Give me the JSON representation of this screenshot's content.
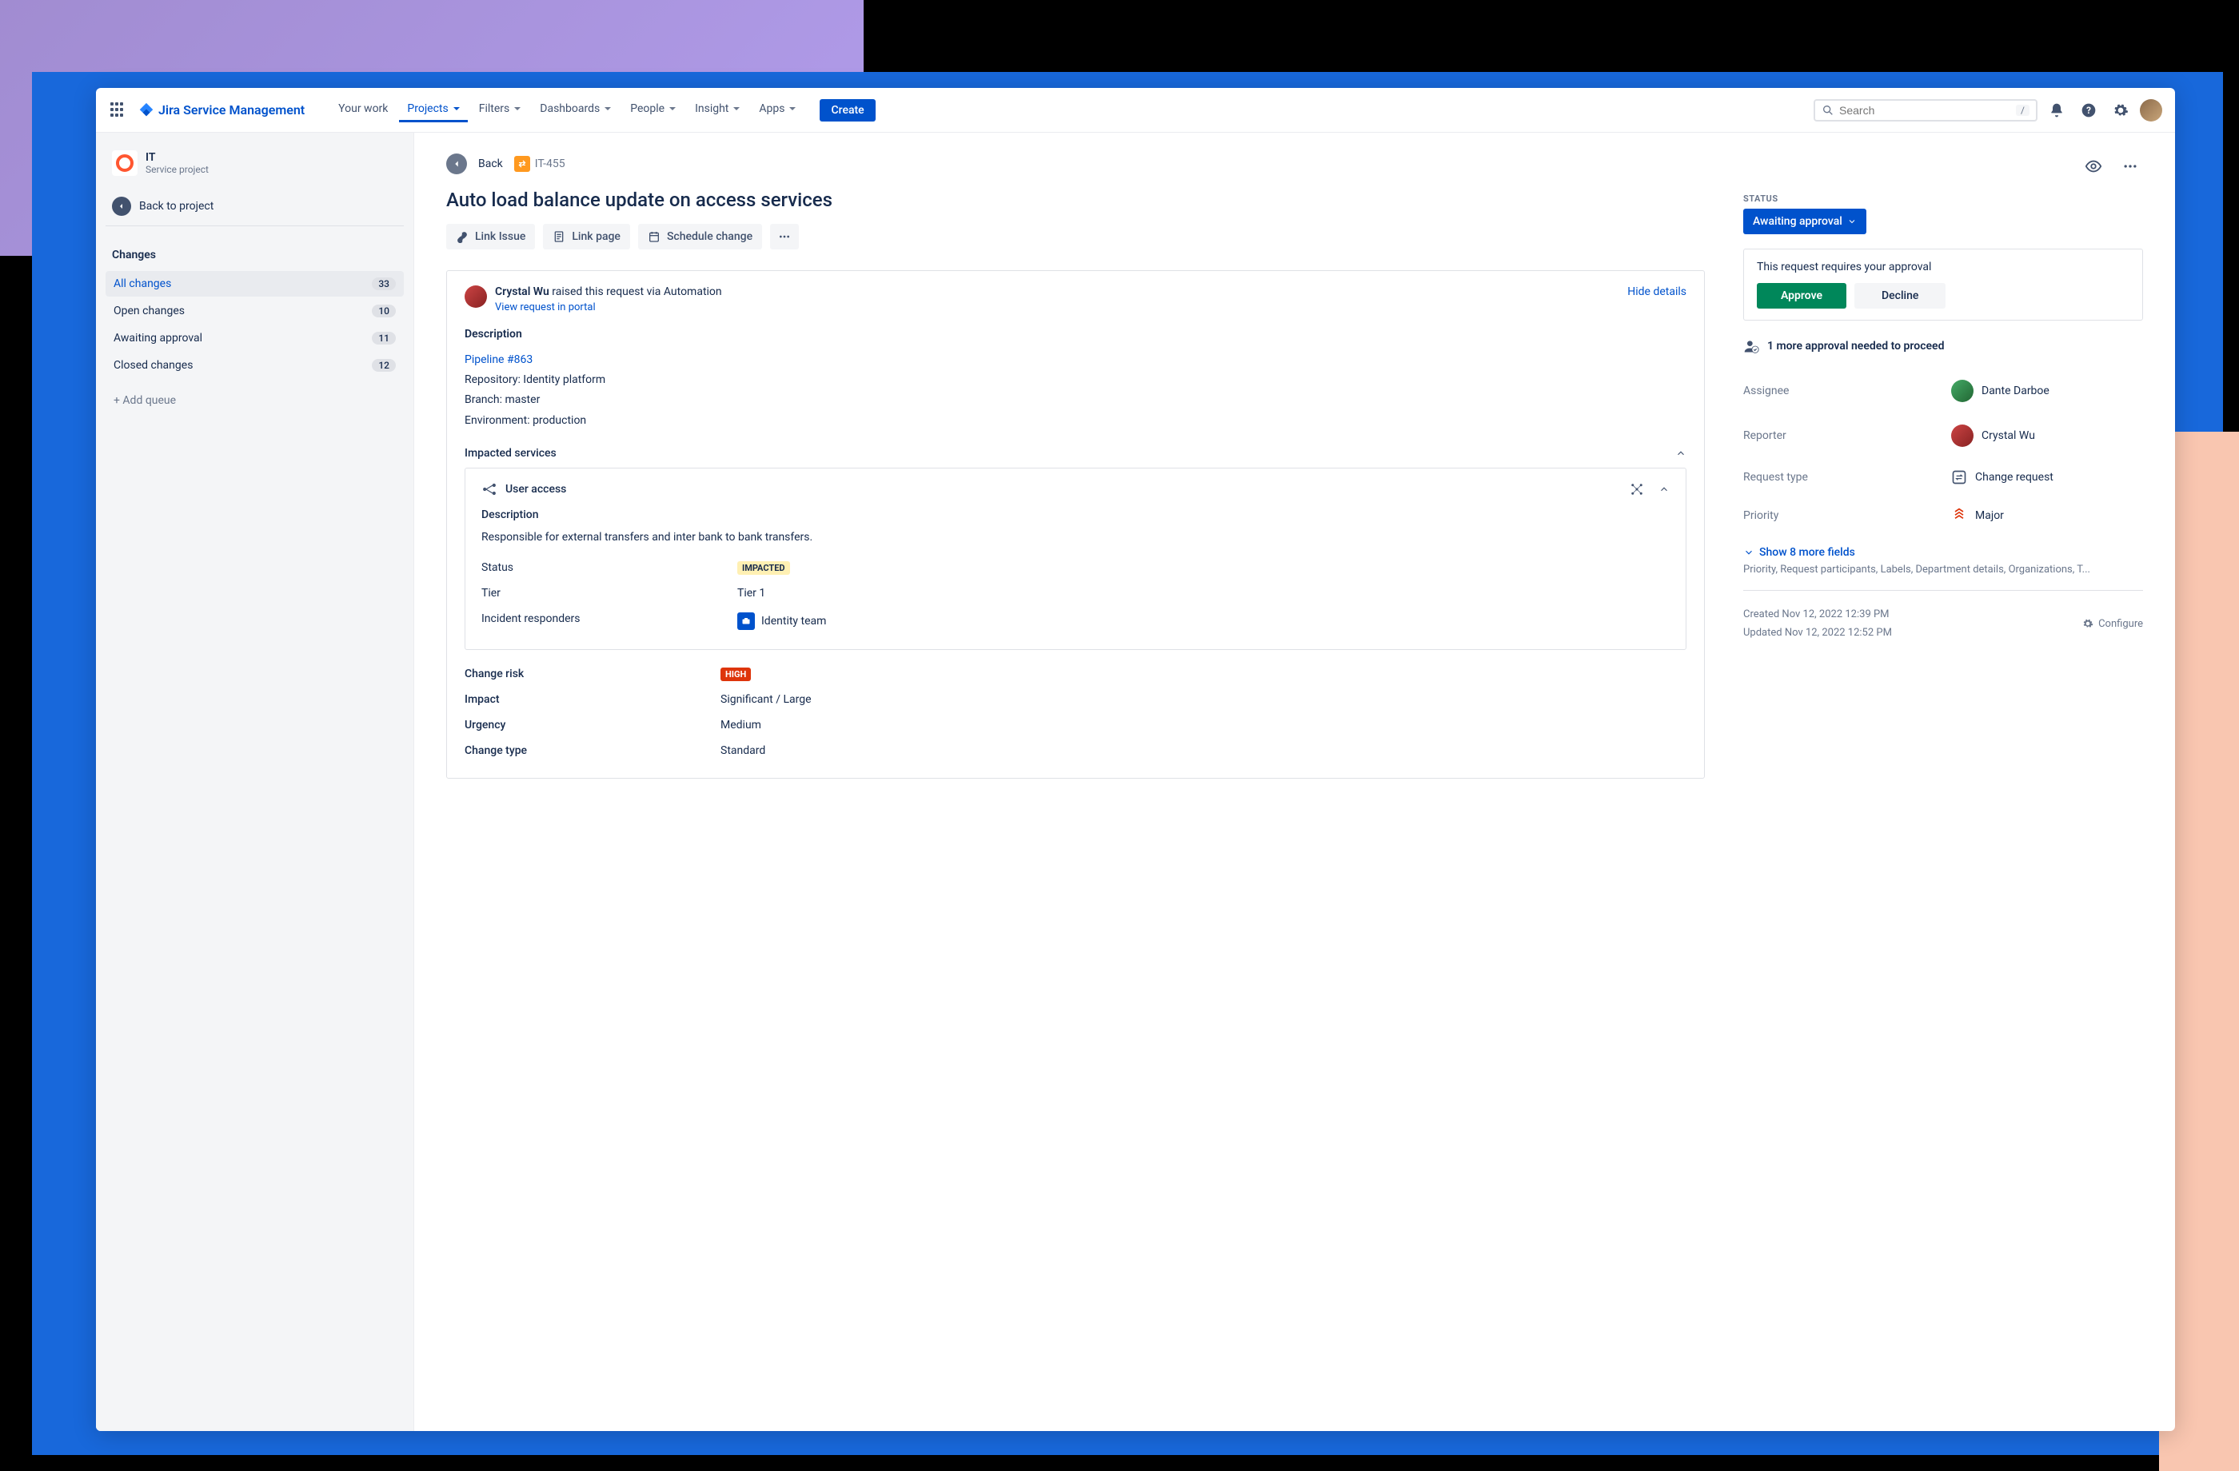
{
  "brand": "Jira Service Management",
  "nav": {
    "your_work": "Your work",
    "projects": "Projects",
    "filters": "Filters",
    "dashboards": "Dashboards",
    "people": "People",
    "insight": "Insight",
    "apps": "Apps",
    "create": "Create",
    "search_placeholder": "Search",
    "search_kbd": "/"
  },
  "sidebar": {
    "project_name": "IT",
    "project_sub": "Service project",
    "back_to_project": "Back to project",
    "heading": "Changes",
    "items": [
      {
        "label": "All changes",
        "count": "33",
        "active": true
      },
      {
        "label": "Open changes",
        "count": "10",
        "active": false
      },
      {
        "label": "Awaiting approval",
        "count": "11",
        "active": false
      },
      {
        "label": "Closed changes",
        "count": "12",
        "active": false
      }
    ],
    "add_queue": "+ Add queue"
  },
  "issue": {
    "back": "Back",
    "key": "IT-455",
    "title": "Auto load balance update on access services",
    "actions": {
      "link_issue": "Link Issue",
      "link_page": "Link page",
      "schedule_change": "Schedule change"
    },
    "requester_name": "Crystal Wu",
    "requester_suffix": " raised this request via Automation",
    "view_portal": "View request in portal",
    "hide_details": "Hide details",
    "description_label": "Description",
    "pipeline_link": "Pipeline #863",
    "desc_repo": "Repository: Identity platform",
    "desc_branch": "Branch: master",
    "desc_env": "Environment: production",
    "impacted_label": "Impacted services",
    "service": {
      "name": "User access",
      "description_label": "Description",
      "description": "Responsible for external transfers and inter bank to bank transfers.",
      "status_label": "Status",
      "status_badge": "IMPACTED",
      "tier_label": "Tier",
      "tier_value": "Tier 1",
      "responders_label": "Incident responders",
      "responders_value": "Identity team"
    },
    "change_risk_label": "Change risk",
    "change_risk_badge": "HIGH",
    "impact_label": "Impact",
    "impact_value": "Significant / Large",
    "urgency_label": "Urgency",
    "urgency_value": "Medium",
    "change_type_label": "Change type",
    "change_type_value": "Standard"
  },
  "right": {
    "status_label": "STATUS",
    "status_value": "Awaiting approval",
    "approval_msg": "This request requires your approval",
    "approve": "Approve",
    "decline": "Decline",
    "approvals_needed": "1 more approval needed to proceed",
    "fields": {
      "assignee_label": "Assignee",
      "assignee_value": "Dante Darboe",
      "reporter_label": "Reporter",
      "reporter_value": "Crystal Wu",
      "request_type_label": "Request type",
      "request_type_value": "Change request",
      "priority_label": "Priority",
      "priority_value": "Major"
    },
    "show_more": "Show 8 more fields",
    "more_hint": "Priority, Request participants, Labels, Department details, Organizations, T...",
    "created": "Created Nov 12, 2022 12:39 PM",
    "updated": "Updated Nov 12, 2022 12:52 PM",
    "configure": "Configure"
  }
}
